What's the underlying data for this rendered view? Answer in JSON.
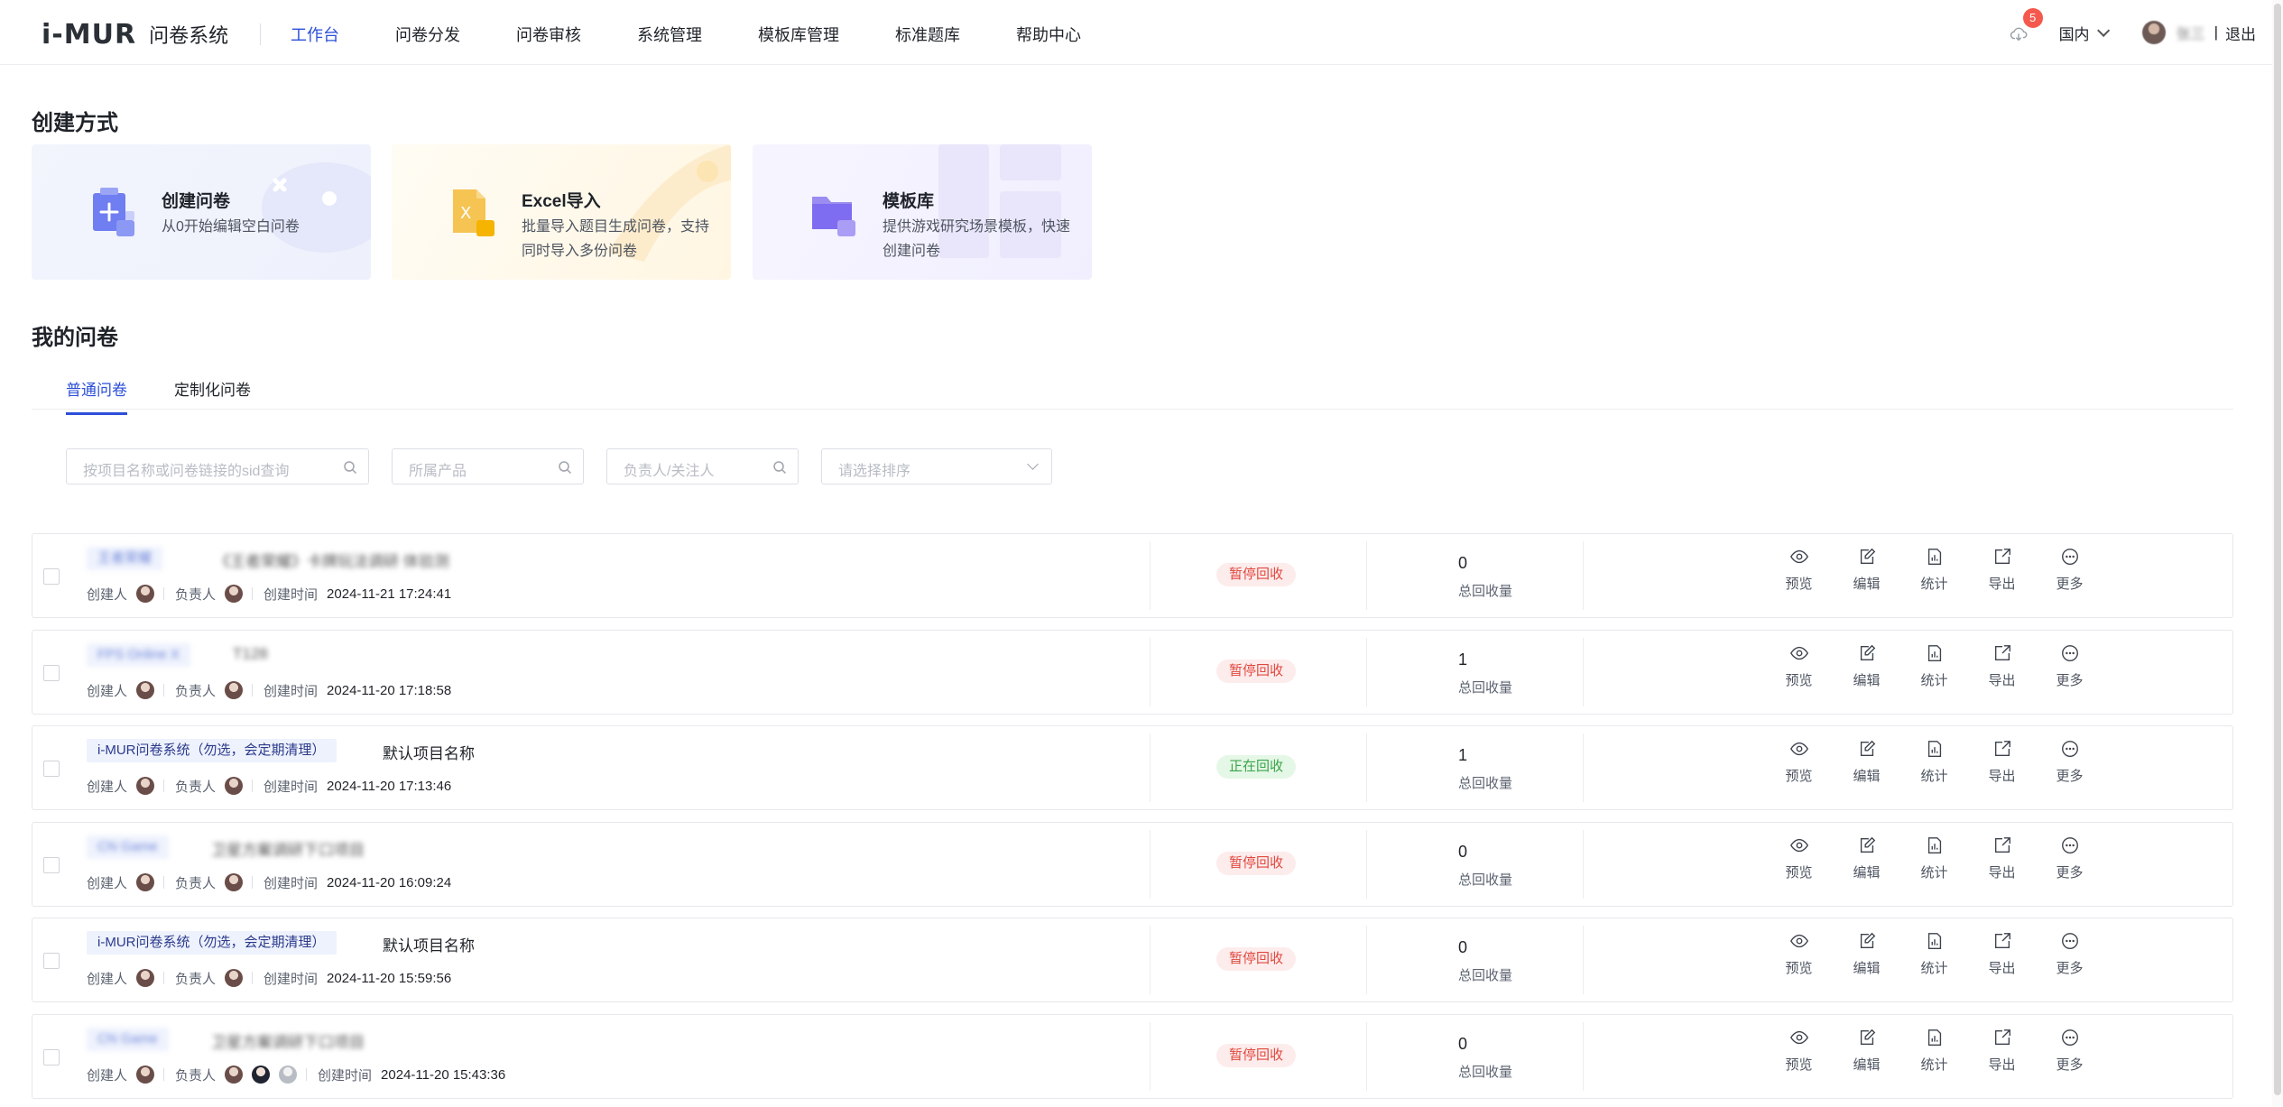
{
  "header": {
    "logo_mark": "i-MUR",
    "logo_text": "问卷系统",
    "nav": [
      "工作台",
      "问卷分发",
      "问卷审核",
      "系统管理",
      "模板库管理",
      "标准题库",
      "帮助中心"
    ],
    "active_nav": "工作台",
    "notification_count": "5",
    "region": "国内",
    "user_name": "张三",
    "logout": "退出"
  },
  "create": {
    "title": "创建方式",
    "cards": [
      {
        "title": "创建问卷",
        "desc": "从0开始编辑空白问卷",
        "icon": "add-doc-icon"
      },
      {
        "title": "Excel导入",
        "desc": "批量导入题目生成问卷，支持同时导入多份问卷",
        "icon": "excel-icon"
      },
      {
        "title": "模板库",
        "desc": "提供游戏研究场景模板，快速创建问卷",
        "icon": "folder-icon"
      }
    ]
  },
  "my": {
    "title": "我的问卷",
    "tabs": [
      "普通问卷",
      "定制化问卷"
    ],
    "active_tab": "普通问卷"
  },
  "filters": {
    "search_placeholder": "按项目名称或问卷链接的sid查询",
    "product_placeholder": "所属产品",
    "owner_placeholder": "负责人/关注人",
    "sort_placeholder": "请选择排序"
  },
  "labels": {
    "creator": "创建人",
    "owner": "负责人",
    "created_time": "创建时间",
    "total": "总回收量",
    "actions": [
      "预览",
      "编辑",
      "统计",
      "导出",
      "更多"
    ]
  },
  "rows": [
    {
      "tag": "王者荣耀",
      "name": "《王者荣耀》卡牌玩法调研 体验测",
      "time": "2024-11-21 17:24:41",
      "status": "暂停回收",
      "count": "0",
      "blur": true
    },
    {
      "tag": "FPS Online X",
      "name": "T128",
      "time": "2024-11-20 17:18:58",
      "status": "暂停回收",
      "count": "1",
      "blur": true
    },
    {
      "tag": "i-MUR问卷系统（勿选，会定期清理）",
      "name": "默认项目名称",
      "time": "2024-11-20 17:13:46",
      "status": "正在回收",
      "count": "1",
      "blur": false
    },
    {
      "tag": "CN Game",
      "name": "卫星方案调研下口项目",
      "time": "2024-11-20 16:09:24",
      "status": "暂停回收",
      "count": "0",
      "blur": true
    },
    {
      "tag": "i-MUR问卷系统（勿选，会定期清理）",
      "name": "默认项目名称",
      "time": "2024-11-20 15:59:56",
      "status": "暂停回收",
      "count": "0",
      "blur": false
    },
    {
      "tag": "CN Game",
      "name": "卫星方案调研下口项目",
      "time": "2024-11-20 15:43:36",
      "status": "暂停回收",
      "count": "0",
      "blur": true
    }
  ],
  "colors": {
    "accent": "#2c4fd8",
    "paused_bg": "#fdecec",
    "paused_text": "#e0483f",
    "active_bg": "#e5f7e6",
    "active_text": "#3aa54a"
  }
}
